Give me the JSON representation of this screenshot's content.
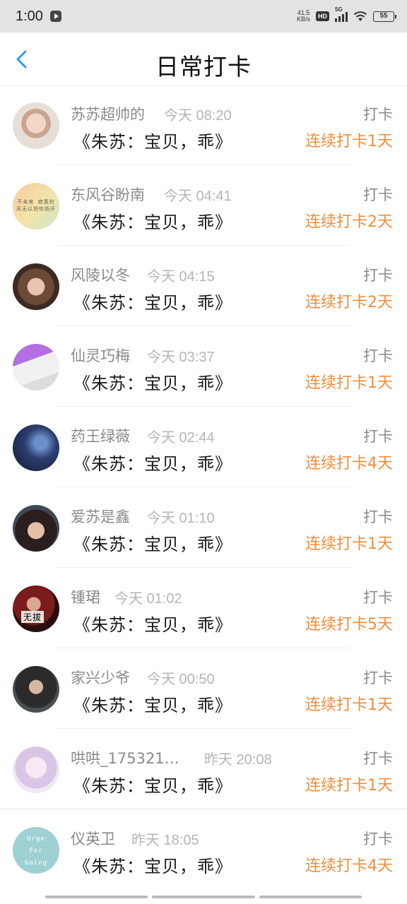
{
  "status_bar": {
    "time": "1:00",
    "net_speed_value": "41.5",
    "net_speed_unit": "KB/s",
    "hd": "HD",
    "network": "5G",
    "battery": "55"
  },
  "header": {
    "title": "日常打卡"
  },
  "checkins": [
    {
      "name": "苏苏超帅的",
      "time": "今天 08:20",
      "book": "《朱苏：宝贝，乖》",
      "action": "打卡",
      "streak": "连续打卡1天"
    },
    {
      "name": "东风谷盼南",
      "time": "今天 04:41",
      "book": "《朱苏：宝贝，乖》",
      "action": "打卡",
      "streak": "连续打卡2天"
    },
    {
      "name": "风陵以冬",
      "time": "今天 04:15",
      "book": "《朱苏：宝贝，乖》",
      "action": "打卡",
      "streak": "连续打卡2天"
    },
    {
      "name": "仙灵巧梅",
      "time": "今天 03:37",
      "book": "《朱苏：宝贝，乖》",
      "action": "打卡",
      "streak": "连续打卡1天"
    },
    {
      "name": "药王绿薇",
      "time": "今天 02:44",
      "book": "《朱苏：宝贝，乖》",
      "action": "打卡",
      "streak": "连续打卡4天"
    },
    {
      "name": "爱苏是鑫",
      "time": "今天 01:10",
      "book": "《朱苏：宝贝，乖》",
      "action": "打卡",
      "streak": "连续打卡1天"
    },
    {
      "name": "锺珺",
      "time": "今天 01:02",
      "book": "《朱苏：宝贝，乖》",
      "action": "打卡",
      "streak": "连续打卡5天"
    },
    {
      "name": "家兴少爷",
      "time": "今天 00:50",
      "book": "《朱苏：宝贝，乖》",
      "action": "打卡",
      "streak": "连续打卡1天"
    },
    {
      "name": "哄哄_175321…",
      "time": "昨天 20:08",
      "book": "《朱苏：宝贝，乖》",
      "action": "打卡",
      "streak": "连续打卡1天"
    },
    {
      "name": "仪英卫",
      "time": "昨天 18:05",
      "book": "《朱苏：宝贝，乖》",
      "action": "打卡",
      "streak": "连续打卡4天"
    }
  ],
  "avatar_text": {
    "second": "不未来 寂寞的 风无以把你扬开",
    "seventh": "无拔",
    "last": [
      "Urge",
      "For",
      "Going"
    ]
  },
  "colors": {
    "accent": "#2a9df4",
    "streak": "#f28c3a",
    "muted": "#8a8a8a"
  }
}
